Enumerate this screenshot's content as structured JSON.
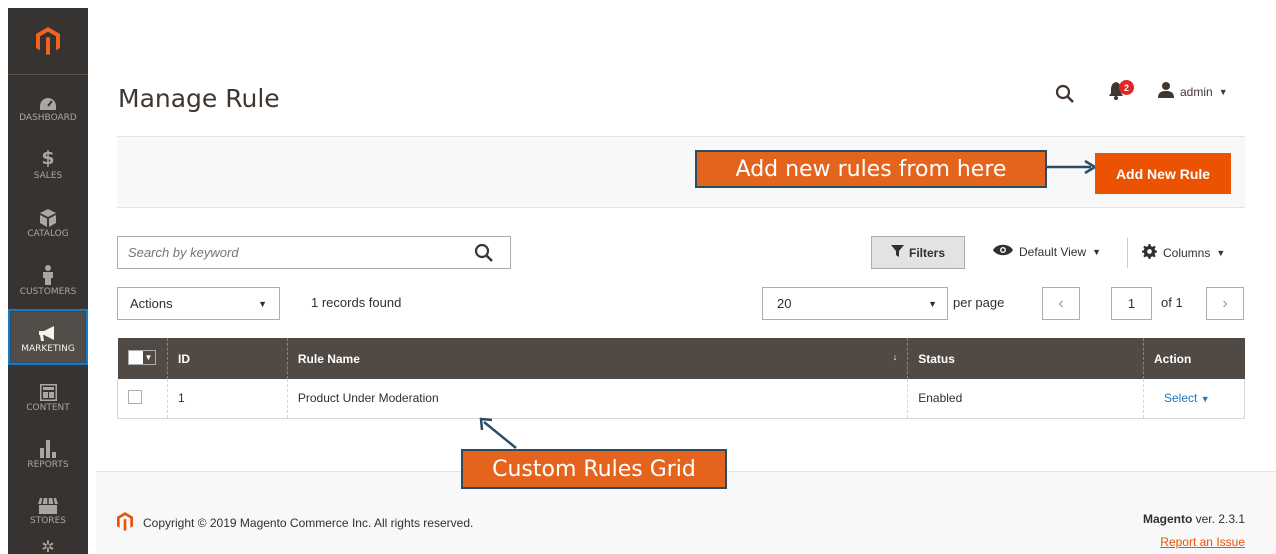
{
  "sidebar": {
    "items": [
      {
        "label": "DASHBOARD",
        "icon": "dashboard-icon"
      },
      {
        "label": "SALES",
        "icon": "dollar-icon"
      },
      {
        "label": "CATALOG",
        "icon": "catalog-box-icon"
      },
      {
        "label": "CUSTOMERS",
        "icon": "customer-icon"
      },
      {
        "label": "MARKETING",
        "icon": "megaphone-icon",
        "active": true
      },
      {
        "label": "CONTENT",
        "icon": "content-icon"
      },
      {
        "label": "REPORTS",
        "icon": "bar-chart-icon"
      },
      {
        "label": "STORES",
        "icon": "store-icon"
      }
    ]
  },
  "header": {
    "title": "Manage Rule",
    "notifications_count": "2",
    "user": "admin"
  },
  "action_bar": {
    "add_button": "Add New Rule"
  },
  "annotations": {
    "top": "Add new rules from here",
    "bottom": "Custom Rules Grid"
  },
  "toolbar": {
    "search_placeholder": "Search by keyword",
    "filters": "Filters",
    "default_view": "Default View",
    "columns": "Columns",
    "actions": "Actions",
    "records_found": "1 records found",
    "per_page_value": "20",
    "per_page_label": "per page",
    "page_current": "1",
    "page_of": "of 1"
  },
  "grid": {
    "columns": [
      "ID",
      "Rule Name",
      "Status",
      "Action"
    ],
    "rows": [
      {
        "id": "1",
        "name": "Product Under Moderation",
        "status": "Enabled",
        "action": "Select"
      }
    ]
  },
  "footer": {
    "copyright": "Copyright © 2019 Magento Commerce Inc. All rights reserved.",
    "brand": "Magento",
    "version": " ver. 2.3.1",
    "report": "Report an Issue"
  },
  "colors": {
    "accent": "#eb5202",
    "sidebar": "#373330",
    "grid_header": "#514943",
    "link": "#1979c3"
  }
}
